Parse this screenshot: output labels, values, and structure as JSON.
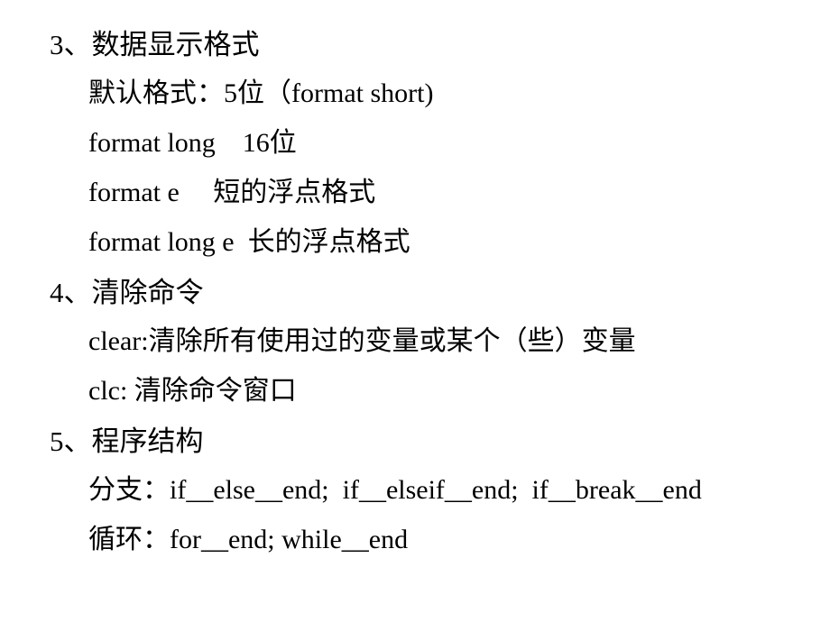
{
  "slide": {
    "background_color": "#ffffff",
    "text_color": "#000000",
    "lines": [
      {
        "id": "section-3-heading",
        "level": 0,
        "text": "3、数据显示格式"
      },
      {
        "id": "default-format",
        "level": 1,
        "text": "默认格式：5位（format short)"
      },
      {
        "id": "format-long",
        "level": 1,
        "text": "format long    16位"
      },
      {
        "id": "format-e",
        "level": 1,
        "text": "format e     短的浮点格式"
      },
      {
        "id": "format-long-e",
        "level": 1,
        "text": "format long e  长的浮点格式"
      },
      {
        "id": "section-4-heading",
        "level": 0,
        "text": "4、清除命令"
      },
      {
        "id": "clear-command",
        "level": 1,
        "text": "clear:清除所有使用过的变量或某个（些）变量"
      },
      {
        "id": "clc-command",
        "level": 1,
        "text": "clc: 清除命令窗口"
      },
      {
        "id": "section-5-heading",
        "level": 0,
        "text": "5、程序结构"
      },
      {
        "id": "branch-structures",
        "level": 1,
        "text": "分支：if__else__end;  if__elseif__end;  if__break__end"
      },
      {
        "id": "loop-structures",
        "level": 1,
        "text": "循环：for__end; while__end"
      }
    ]
  }
}
